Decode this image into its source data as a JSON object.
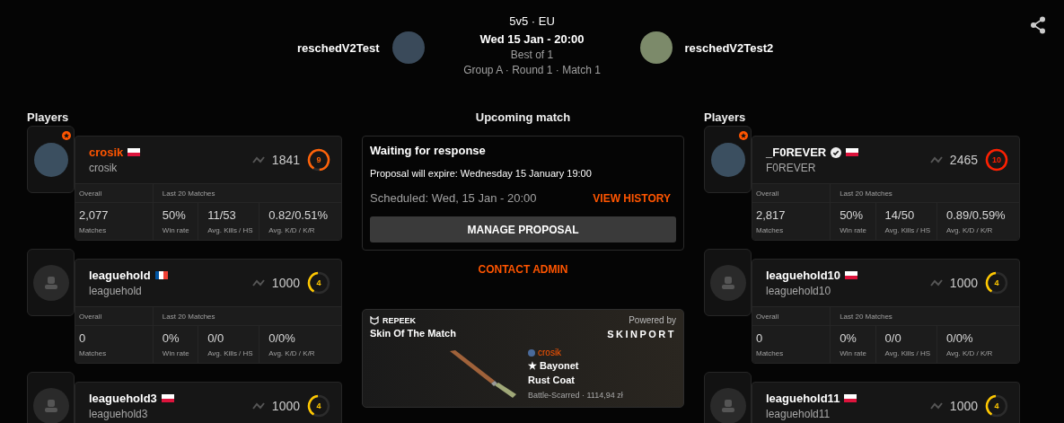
{
  "header": {
    "format": "5v5 · EU",
    "date": "Wed 15 Jan - 20:00",
    "best_of": "Best of 1",
    "stage": "Group A · Round 1 · Match 1",
    "team_1": {
      "name": "reschedV2Test"
    },
    "team_2": {
      "name": "reschedV2Test2"
    }
  },
  "left": {
    "title": "Players",
    "players": [
      {
        "nickname": "crosik",
        "game_name": "crosik",
        "flag": {
          "kind": "pl"
        },
        "highlighted": true,
        "verified": false,
        "kind": "photo",
        "premium": true,
        "elo": "1841",
        "skill_level": "9",
        "stats": {
          "overall_label": "Overall",
          "recent_label": "Last 20 Matches",
          "items": [
            {
              "value": "2,077",
              "label": "Matches"
            },
            {
              "value": "50%",
              "label": "Win rate"
            },
            {
              "value": "11/53",
              "label": "Avg. Kills / HS"
            },
            {
              "value": "0.82/0.51%",
              "label": "Avg. K/D / K/R"
            }
          ]
        }
      },
      {
        "nickname": "leaguehold",
        "game_name": "leaguehold",
        "flag": {
          "kind": "fr"
        },
        "highlighted": false,
        "verified": false,
        "kind": "default",
        "premium": false,
        "elo": "1000",
        "skill_level": "4",
        "stats": {
          "overall_label": "Overall",
          "recent_label": "Last 20 Matches",
          "items": [
            {
              "value": "0",
              "label": "Matches"
            },
            {
              "value": "0%",
              "label": "Win rate"
            },
            {
              "value": "0/0",
              "label": "Avg. Kills / HS"
            },
            {
              "value": "0/0%",
              "label": "Avg. K/D / K/R"
            }
          ]
        }
      },
      {
        "nickname": "leaguehold3",
        "game_name": "leaguehold3",
        "flag": {
          "kind": "pl"
        },
        "highlighted": false,
        "verified": false,
        "kind": "default",
        "premium": false,
        "elo": "1000",
        "skill_level": "4"
      }
    ]
  },
  "center": {
    "title": "Upcoming match",
    "proposal": {
      "status": "Waiting for response",
      "expiry": "Proposal will expire: Wednesday 15 January 19:00",
      "scheduled": "Scheduled: Wed, 15 Jan - 20:00",
      "history_link": "VIEW HISTORY",
      "manage_button": "MANAGE PROPOSAL"
    },
    "contact_link": "CONTACT ADMIN",
    "skin": {
      "brand": "REPEEK",
      "title": "Skin Of The Match",
      "powered_by": "Powered by",
      "partner": "SKINPORT",
      "owner": "crosik",
      "weapon": "★ Bayonet",
      "finish": "Rust Coat",
      "details": "Battle-Scarred · 1114,94 zł"
    }
  },
  "right": {
    "title": "Players",
    "players": [
      {
        "nickname": "_F0REVER",
        "game_name": "F0REVER",
        "flag": {
          "kind": "pl"
        },
        "highlighted": false,
        "verified": true,
        "kind": "photo",
        "premium": true,
        "elo": "2465",
        "skill_level": "10",
        "stats": {
          "overall_label": "Overall",
          "recent_label": "Last 20 Matches",
          "items": [
            {
              "value": "2,817",
              "label": "Matches"
            },
            {
              "value": "50%",
              "label": "Win rate"
            },
            {
              "value": "14/50",
              "label": "Avg. Kills / HS"
            },
            {
              "value": "0.89/0.59%",
              "label": "Avg. K/D / K/R"
            }
          ]
        }
      },
      {
        "nickname": "leaguehold10",
        "game_name": "leaguehold10",
        "flag": {
          "kind": "pl"
        },
        "highlighted": false,
        "verified": false,
        "kind": "default",
        "premium": false,
        "elo": "1000",
        "skill_level": "4",
        "stats": {
          "overall_label": "Overall",
          "recent_label": "Last 20 Matches",
          "items": [
            {
              "value": "0",
              "label": "Matches"
            },
            {
              "value": "0%",
              "label": "Win rate"
            },
            {
              "value": "0/0",
              "label": "Avg. Kills / HS"
            },
            {
              "value": "0/0%",
              "label": "Avg. K/D / K/R"
            }
          ]
        }
      },
      {
        "nickname": "leaguehold11",
        "game_name": "leaguehold11",
        "flag": {
          "kind": "pl"
        },
        "highlighted": false,
        "verified": false,
        "kind": "default",
        "premium": false,
        "elo": "1000",
        "skill_level": "4"
      }
    ]
  }
}
